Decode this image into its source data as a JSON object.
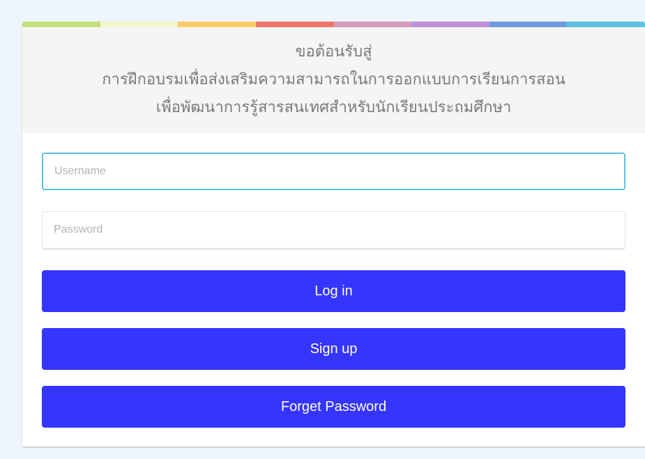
{
  "header": {
    "line1": "ขอต้อนรับสู่",
    "line2": "การฝึกอบรมเพื่อส่งเสริมความสามารถในการออกแบบการเรียนการสอน",
    "line3": "เพื่อพัฒนาการรู้สารสนเทศสำหรับนักเรียนประถมศึกษา"
  },
  "color_strip": [
    "#c5e07e",
    "#f1f7c8",
    "#fbcd6a",
    "#f0756a",
    "#d99bb8",
    "#bf92da",
    "#6f9ae0",
    "#5fc2e2"
  ],
  "form": {
    "username_placeholder": "Username",
    "username_value": "",
    "password_placeholder": "Password",
    "password_value": ""
  },
  "buttons": {
    "login": "Log in",
    "signup": "Sign up",
    "forget": "Forget Password"
  },
  "colors": {
    "button": "#3535ff",
    "focus_border": "#5bc0de",
    "page_bg": "#eef5fd"
  }
}
